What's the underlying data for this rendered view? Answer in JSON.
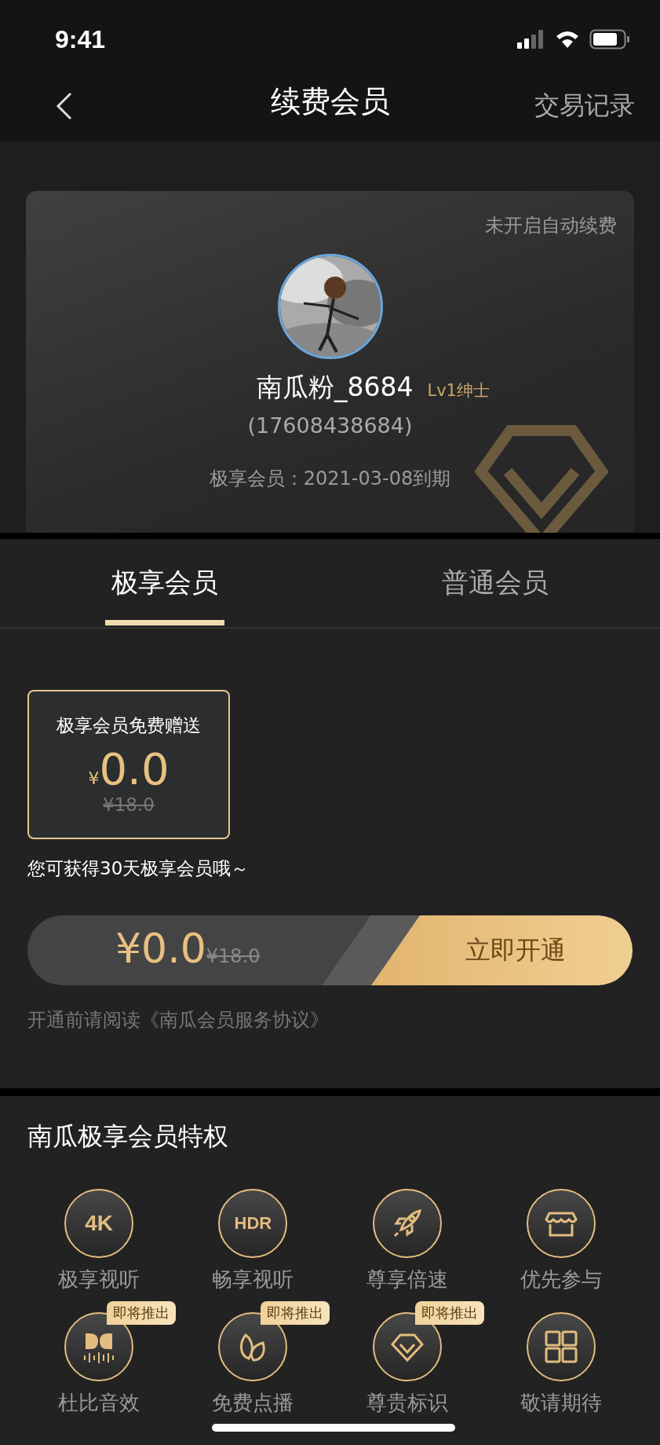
{
  "status_bar": {
    "time": "9:41"
  },
  "nav": {
    "title": "续费会员",
    "action": "交易记录"
  },
  "profile": {
    "auto_renew": "未开启自动续费",
    "name": "南瓜粉_8684",
    "level_badge": "Lv1绅士",
    "phone": "(17608438684)",
    "expiry": "极享会员：2021-03-08到期"
  },
  "tabs": [
    {
      "label": "极享会员",
      "selected": true
    },
    {
      "label": "普通会员",
      "selected": false
    }
  ],
  "plans": [
    {
      "title": "极享会员免费赠送",
      "currency": "¥",
      "price": "0.0",
      "original_price": "¥18.0",
      "selected": true
    }
  ],
  "note": "您可获得30天极享会员哦～",
  "purchase": {
    "price": "¥0.0",
    "original_price": "¥18.0",
    "button": "立即开通"
  },
  "agreement": "开通前请阅读《南瓜会员服务协议》",
  "privileges": {
    "title": "南瓜极享会员特权",
    "items": [
      {
        "kind": "text",
        "icon_text": "4K",
        "label": "极享视听"
      },
      {
        "kind": "text",
        "icon_text": "HDR",
        "label": "畅享视听"
      },
      {
        "kind": "rocket",
        "label": "尊享倍速"
      },
      {
        "kind": "store",
        "label": "优先参与"
      },
      {
        "kind": "dolby",
        "label": "杜比音效",
        "badge": "即将推出"
      },
      {
        "kind": "leaves",
        "label": "免费点播",
        "badge": "即将推出"
      },
      {
        "kind": "diamond",
        "label": "尊贵标识",
        "badge": "即将推出"
      },
      {
        "kind": "grid",
        "label": "敬请期待"
      }
    ]
  }
}
